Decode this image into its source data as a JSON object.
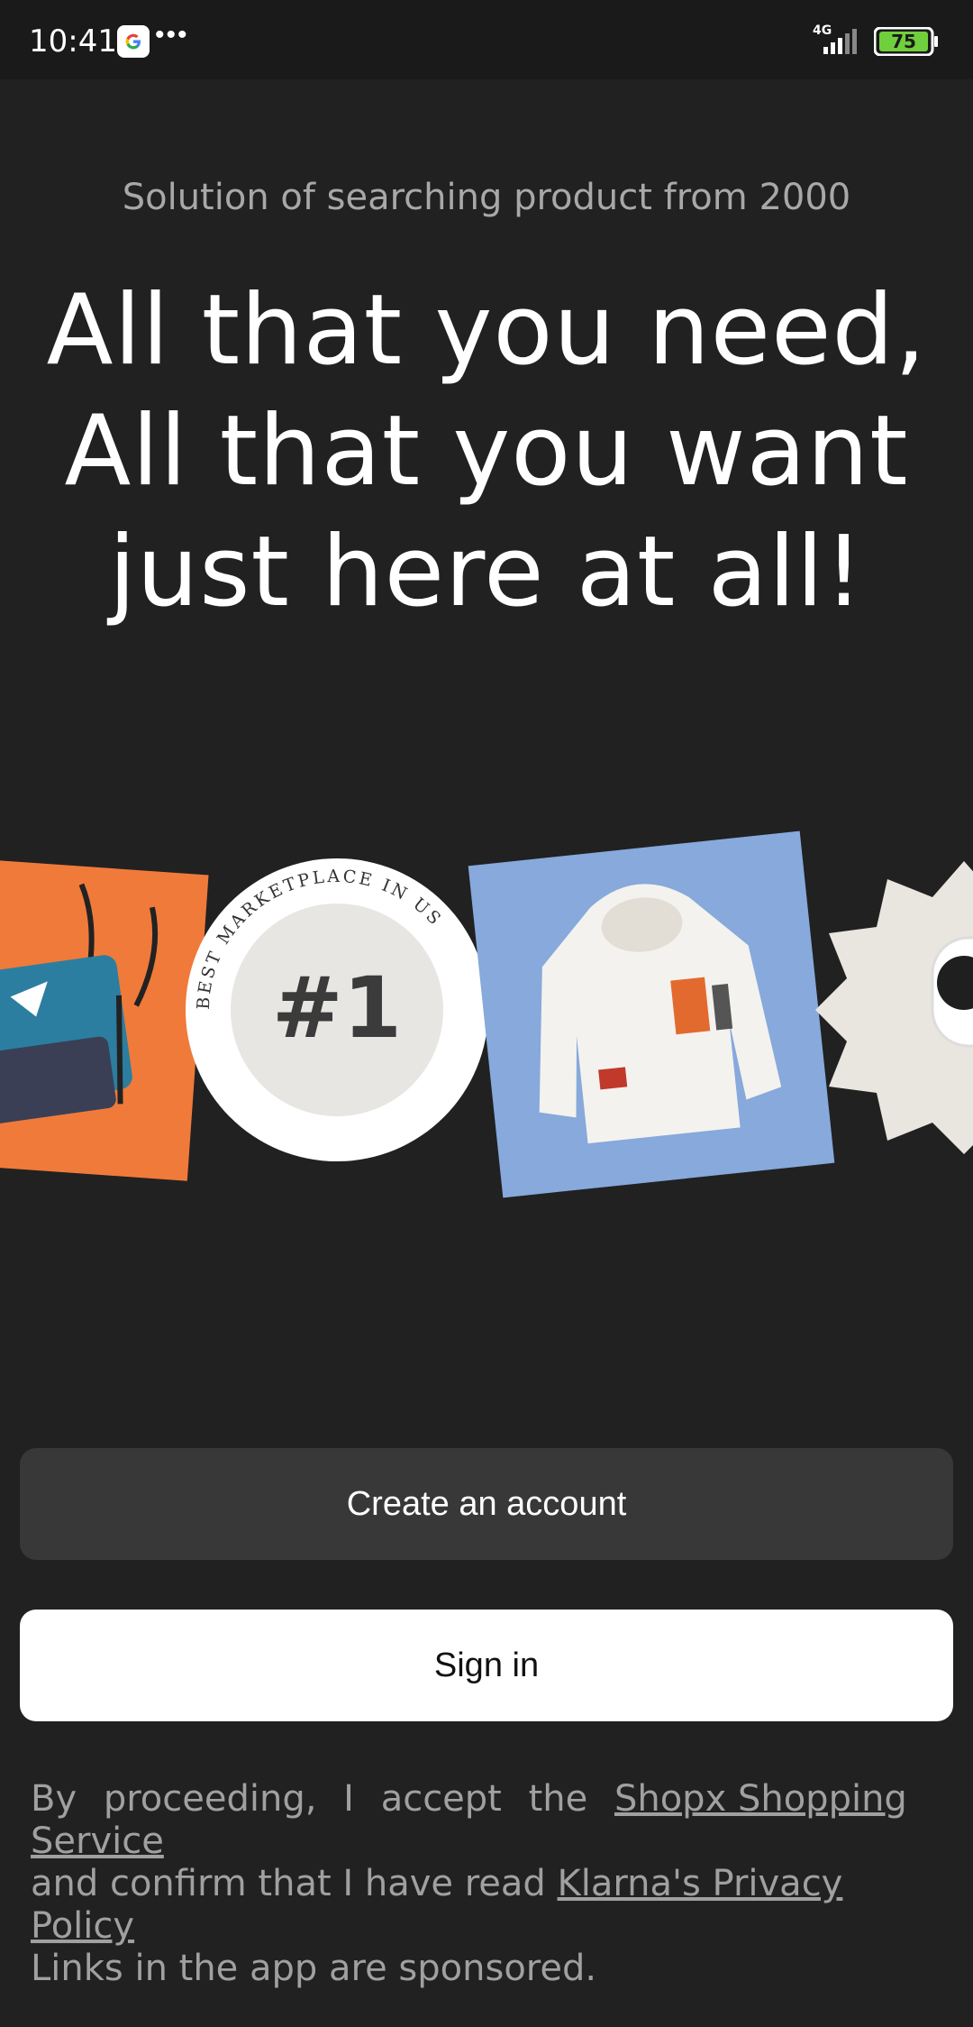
{
  "status_bar": {
    "time": "10:41",
    "network": "4G",
    "battery": "75",
    "icons": [
      "google-icon",
      "more-dots-icon",
      "signal-icon",
      "battery-icon"
    ]
  },
  "hero": {
    "subtitle": "Solution of searching product from 2000",
    "headline_lines": [
      "All that you need,",
      "All that you want",
      "just here at all!"
    ]
  },
  "carousel": {
    "badge": {
      "number": "#1",
      "ring_text": "BEST MARKETPLACE IN US"
    },
    "items": [
      "bag-image",
      "best-marketplace-badge",
      "hoodie-image",
      "camera-image"
    ]
  },
  "actions": {
    "create_label": "Create an account",
    "signin_label": "Sign in"
  },
  "legal": {
    "words": [
      "By",
      "proceeding,",
      "I",
      "accept",
      "the"
    ],
    "service_link": "Shopx Shopping Service",
    "line2_text": "and confirm that I have read",
    "privacy_link": "Klarna's Privacy Policy",
    "line3_text": "Links in the app are sponsored."
  },
  "colors": {
    "background": "#212121",
    "create_button": "#383838",
    "signin_button": "#ffffff",
    "bag_card": "#f07a3a",
    "hoodie_card": "#87a9db"
  }
}
